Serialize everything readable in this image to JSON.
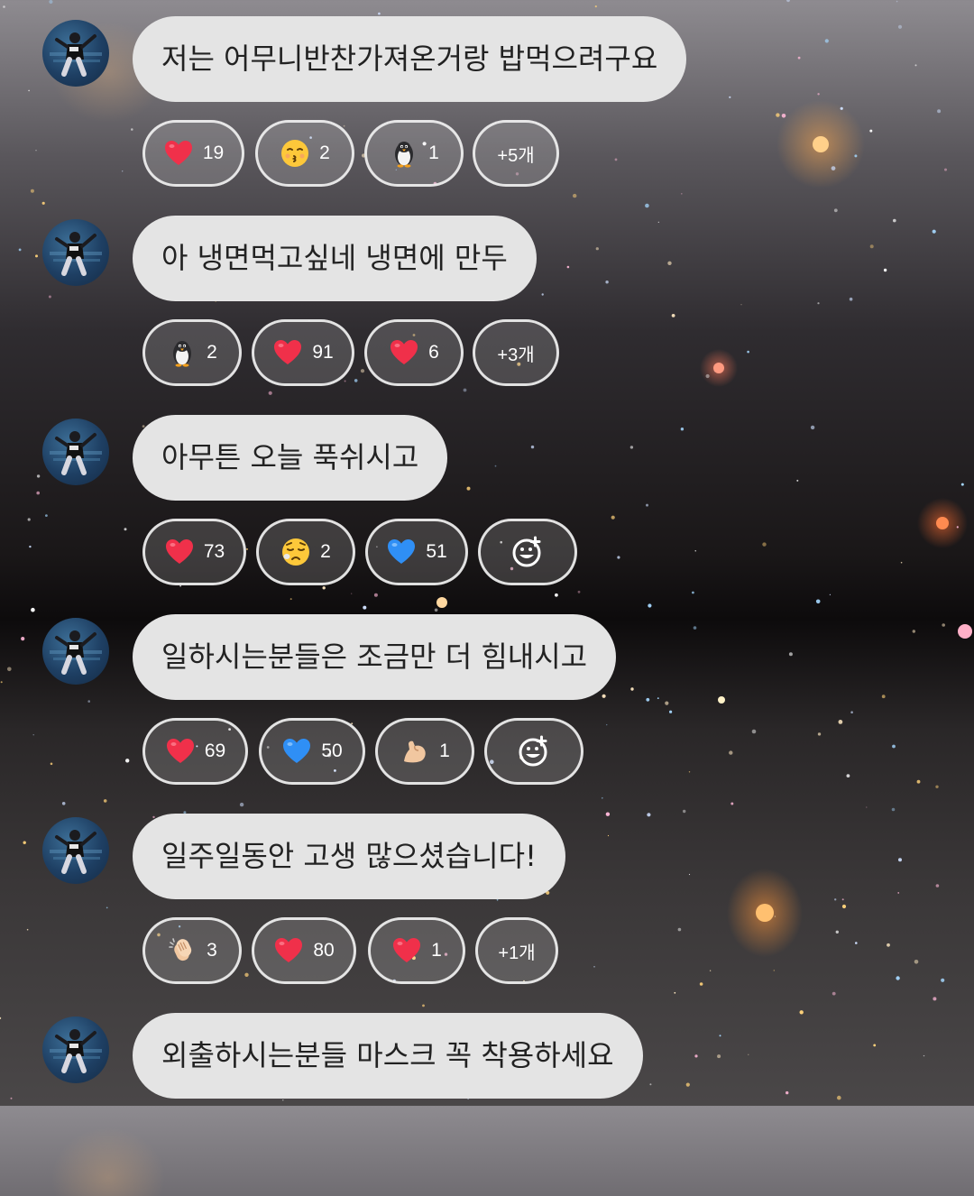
{
  "messages": [
    {
      "text": "저는 어무니반찬가져온거랑 밥먹으려구요",
      "reactions": [
        {
          "icon": "heart-icon",
          "count": "19"
        },
        {
          "icon": "kissing-face-icon",
          "count": "2"
        },
        {
          "icon": "penguin-icon",
          "count": "1"
        },
        {
          "icon": "more",
          "count": "+5개"
        }
      ]
    },
    {
      "text": "아 냉면먹고싶네 냉면에 만두",
      "reactions": [
        {
          "icon": "penguin-icon",
          "count": "2"
        },
        {
          "icon": "heart-icon",
          "count": "91"
        },
        {
          "icon": "heart-icon",
          "count": "6"
        },
        {
          "icon": "more",
          "count": "+3개"
        }
      ]
    },
    {
      "text": "아무튼 오늘 푹쉬시고",
      "reactions": [
        {
          "icon": "heart-icon",
          "count": "73"
        },
        {
          "icon": "sleepy-face-icon",
          "count": "2"
        },
        {
          "icon": "blue-heart-icon",
          "count": "51"
        },
        {
          "icon": "add-reaction-icon",
          "count": ""
        }
      ]
    },
    {
      "text": "일하시는분들은 조금만 더 힘내시고",
      "reactions": [
        {
          "icon": "heart-icon",
          "count": "69"
        },
        {
          "icon": "blue-heart-icon",
          "count": "50"
        },
        {
          "icon": "flexed-biceps-icon",
          "count": "1"
        },
        {
          "icon": "add-reaction-icon",
          "count": ""
        }
      ]
    },
    {
      "text": "일주일동안 고생 많으셨습니다!",
      "reactions": [
        {
          "icon": "clapping-hands-icon",
          "count": "3"
        },
        {
          "icon": "heart-icon",
          "count": "80"
        },
        {
          "icon": "heart-icon",
          "count": "1"
        },
        {
          "icon": "more",
          "count": "+1개"
        }
      ]
    },
    {
      "text": "외출하시는분들 마스크 꼭 착용하세요",
      "reactions": []
    }
  ],
  "colors": {
    "bubble": "#e4e4e4",
    "heart": "#f0304a",
    "blue_heart": "#2f8ff5",
    "chip_border": "#f0f0f0"
  }
}
